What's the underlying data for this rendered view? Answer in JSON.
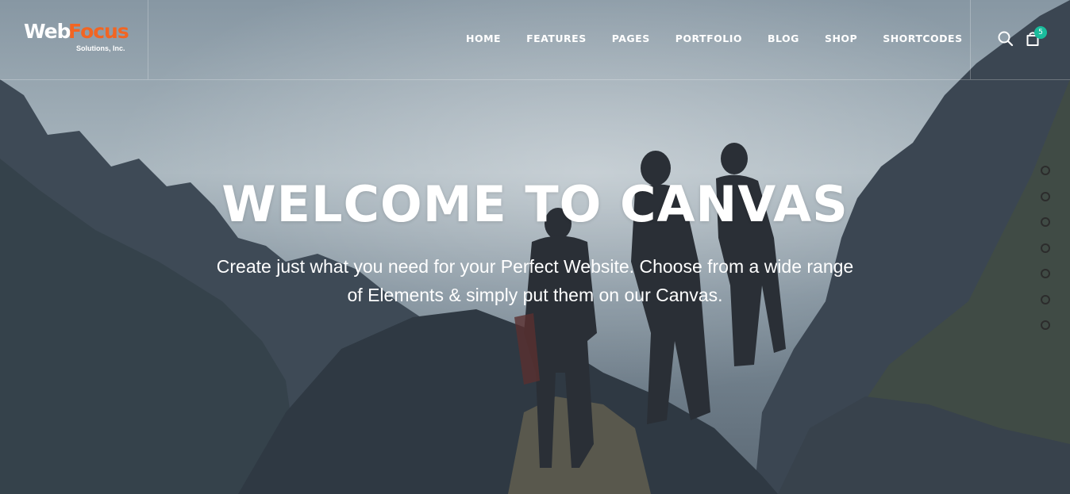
{
  "brand": {
    "name_part1": "Web",
    "name_part2": "Focus",
    "tagline": "Solutions, Inc.",
    "colors": {
      "accent": "#f26522",
      "primary": "#ffffff"
    }
  },
  "nav": {
    "items": [
      "HOME",
      "FEATURES",
      "PAGES",
      "PORTFOLIO",
      "BLOG",
      "SHOP",
      "SHORTCODES"
    ]
  },
  "header_icons": {
    "search": "search-icon",
    "cart": "shopping-bag-icon",
    "cart_count": "5",
    "badge_color": "#1abc9c"
  },
  "hero": {
    "title": "WELCOME TO CANVAS",
    "subtitle": "Create just what you need for your Perfect Website. Choose from a wide range of Elements & simply put them on our Canvas."
  },
  "section_nav": {
    "dot_count": 7
  }
}
